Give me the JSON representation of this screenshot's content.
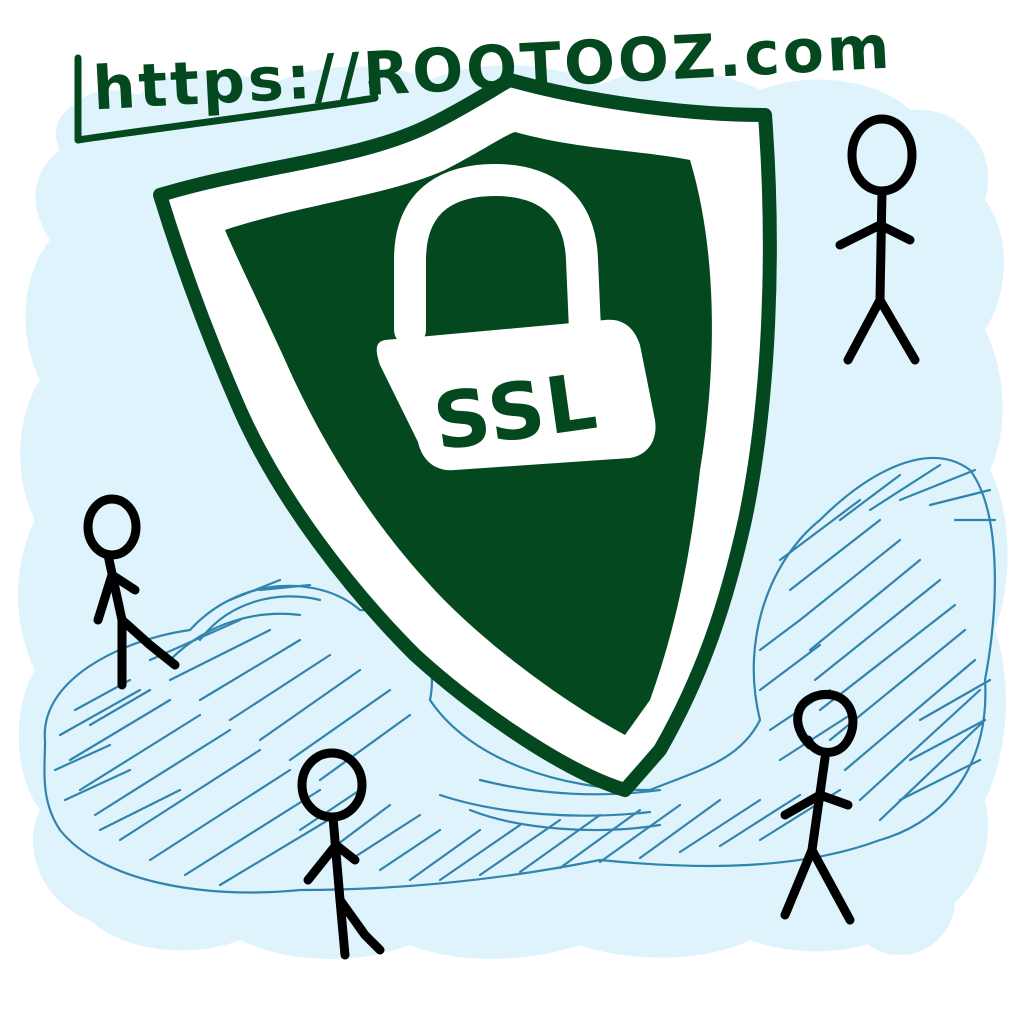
{
  "url_banner": {
    "text": "https://ROOTOOZ.com"
  },
  "badge": {
    "text": "SSL"
  },
  "colors": {
    "ink_green": "#04481f",
    "cloud_blue": "#def3fb",
    "scribble_blue": "#1f78a6",
    "stick_black": "#000000",
    "white": "#ffffff"
  },
  "figures": [
    {
      "name": "stick-figure-top-right",
      "pose": "standing"
    },
    {
      "name": "stick-figure-left",
      "pose": "walking"
    },
    {
      "name": "stick-figure-bottom-center",
      "pose": "walking"
    },
    {
      "name": "stick-figure-bottom-right",
      "pose": "standing"
    }
  ]
}
